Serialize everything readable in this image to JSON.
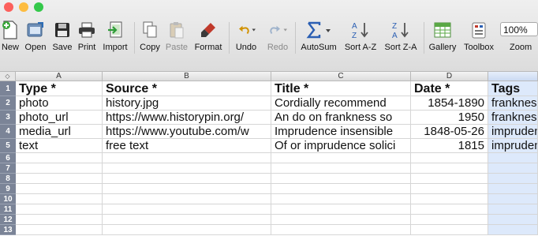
{
  "window": {
    "traffic_colors": [
      "#fc605c",
      "#fdbc40",
      "#34c84a"
    ]
  },
  "toolbar": {
    "buttons": [
      {
        "label": "New",
        "icon": "new-document-icon",
        "enabled": true
      },
      {
        "label": "Open",
        "icon": "open-folder-icon",
        "enabled": true
      },
      {
        "label": "Save",
        "icon": "floppy-disk-icon",
        "enabled": true
      },
      {
        "label": "Print",
        "icon": "printer-icon",
        "enabled": true
      },
      {
        "label": "Import",
        "icon": "import-icon",
        "enabled": true
      },
      {
        "label": "Copy",
        "icon": "copy-icon",
        "enabled": true
      },
      {
        "label": "Paste",
        "icon": "paste-icon",
        "enabled": false
      },
      {
        "label": "Format",
        "icon": "paintbrush-icon",
        "enabled": true
      },
      {
        "label": "Undo",
        "icon": "undo-icon",
        "enabled": true
      },
      {
        "label": "Redo",
        "icon": "redo-icon",
        "enabled": false
      },
      {
        "label": "AutoSum",
        "icon": "sigma-icon",
        "enabled": true
      },
      {
        "label": "Sort A-Z",
        "icon": "sort-ascending-icon",
        "enabled": true
      },
      {
        "label": "Sort Z-A",
        "icon": "sort-descending-icon",
        "enabled": true
      },
      {
        "label": "Gallery",
        "icon": "gallery-icon",
        "enabled": true
      },
      {
        "label": "Toolbox",
        "icon": "toolbox-icon",
        "enabled": true
      }
    ],
    "zoom": {
      "value": "100%",
      "label": "Zoom"
    }
  },
  "sheet": {
    "columns": [
      "A",
      "B",
      "C",
      "D",
      ""
    ],
    "rows": [
      "1",
      "2",
      "3",
      "4",
      "5",
      "6",
      "7",
      "8",
      "9",
      "10",
      "11",
      "12",
      "13"
    ],
    "cells": [
      [
        "Type *",
        "Source *",
        "Title *",
        "Date *",
        "Tags"
      ],
      [
        "photo",
        "history.jpg",
        "Cordially  recommend  ",
        "1854-1890",
        "frankness"
      ],
      [
        "photo_url",
        "https://www.historypin.org/",
        "An do on frankness so",
        "1950",
        "frankness"
      ],
      [
        "media_url",
        "https://www.youtube.com/w",
        "Imprudence insensible",
        "1848-05-26",
        "imprudence"
      ],
      [
        "text",
        "free text",
        "Of or imprudence solici",
        "1815",
        "imprudence"
      ]
    ],
    "colors": {
      "selected_column": "#dde9fb",
      "row_header": "#7b8497"
    }
  }
}
